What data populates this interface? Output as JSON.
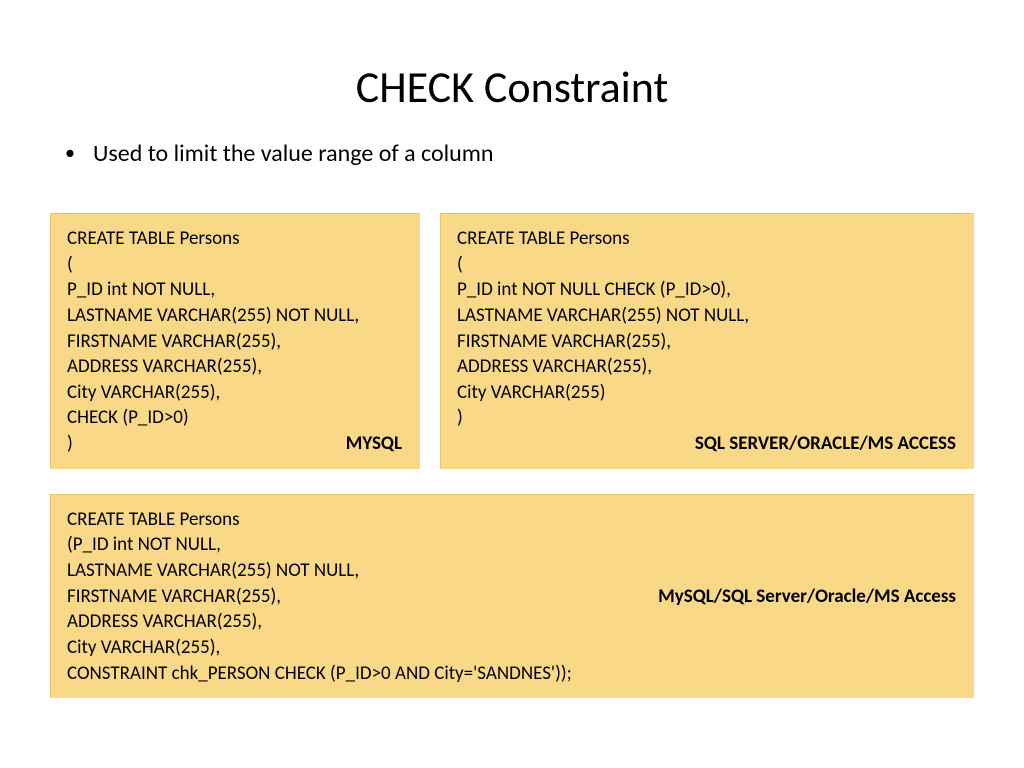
{
  "title": "CHECK Constraint",
  "bullet": "Used to limit the value range of a column",
  "box1": {
    "lines": [
      "CREATE TABLE Persons",
      "(",
      "P_ID int NOT NULL,",
      "LASTNAME VARCHAR(255) NOT NULL,",
      "FIRSTNAME VARCHAR(255),",
      "ADDRESS VARCHAR(255),",
      "City VARCHAR(255),",
      "CHECK (P_ID>0)",
      ")"
    ],
    "label": "MYSQL"
  },
  "box2": {
    "lines": [
      "CREATE TABLE Persons",
      "(",
      "P_ID int NOT NULL CHECK (P_ID>0),",
      "LASTNAME VARCHAR(255) NOT NULL,",
      "FIRSTNAME VARCHAR(255),",
      "ADDRESS VARCHAR(255),",
      "City VARCHAR(255)",
      ")"
    ],
    "label": "SQL SERVER/ORACLE/MS ACCESS"
  },
  "box3": {
    "lines": [
      "CREATE TABLE Persons",
      "(P_ID int NOT NULL,",
      "LASTNAME VARCHAR(255) NOT NULL,",
      "FIRSTNAME VARCHAR(255),",
      "ADDRESS VARCHAR(255),",
      "City VARCHAR(255),",
      "CONSTRAINT chk_PERSON CHECK (P_ID>0 AND City='SANDNES'));"
    ],
    "label": "MySQL/SQL Server/Oracle/MS Access"
  }
}
